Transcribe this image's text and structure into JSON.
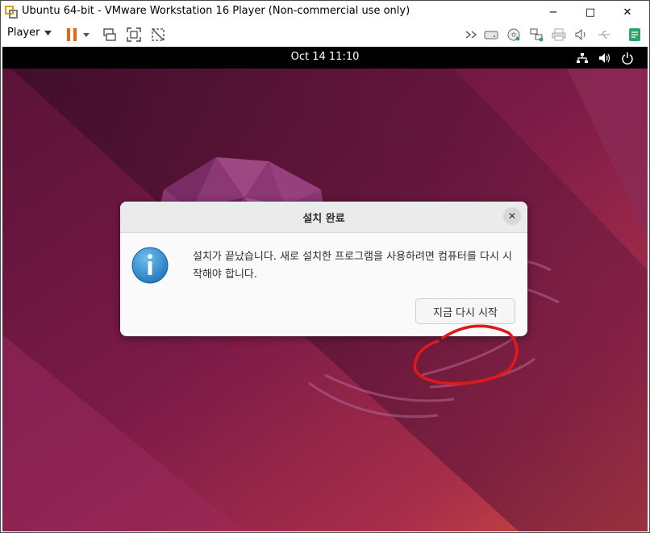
{
  "window": {
    "title": "Ubuntu 64-bit - VMware Workstation 16 Player (Non-commercial use only)",
    "minimize_label": "−",
    "maximize_label": "□",
    "close_label": "✕"
  },
  "toolbar": {
    "player_label": "Player",
    "left_icons": [
      "pause-icon",
      "dropdown-arrow-icon",
      "send-ctrl-alt-del-icon",
      "fullscreen-icon",
      "unity-icon"
    ],
    "right_icons": [
      "more-devices-icon",
      "hard-disk-icon",
      "cd-dvd-icon",
      "network-adapter-icon",
      "printer-icon",
      "sound-card-icon",
      "usb-icon",
      "message-log-icon"
    ],
    "pause_color": "#e8641b",
    "accent_color": "#2aa86b"
  },
  "ubuntu": {
    "clock": "Oct 14  11:10",
    "tray_icons": [
      "network-icon",
      "volume-icon",
      "power-icon"
    ]
  },
  "dialog": {
    "title": "설치 완료",
    "close_label": "✕",
    "message": "설치가 끝났습니다. 새로 설치한 프로그램을 사용하려면 컴퓨터를 다시 시작해야 합니다.",
    "restart_button": "지금 다시 시작",
    "icon": "info-icon"
  }
}
